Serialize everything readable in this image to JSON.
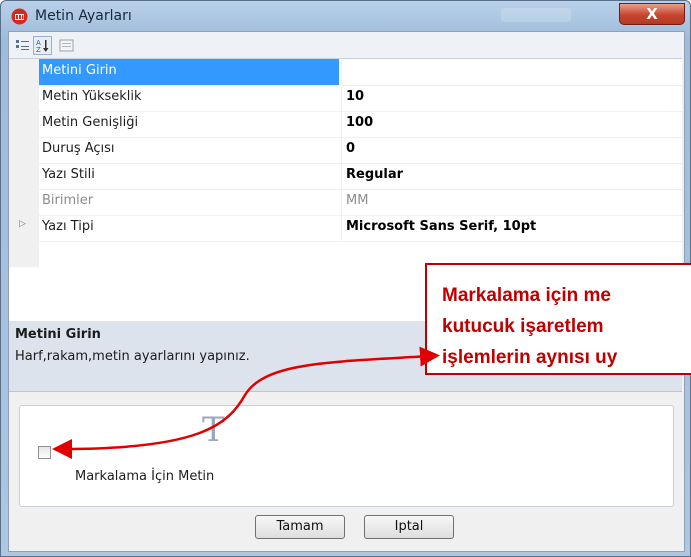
{
  "window": {
    "title": "Metin Ayarları",
    "close_icon": "x-icon",
    "close_glyph": "X"
  },
  "toolbar": {
    "icons": [
      "categorized-icon",
      "alphabetical-sort-icon",
      "property-pages-icon"
    ]
  },
  "property_grid": {
    "rows": [
      {
        "name": "Metini Girin",
        "value": "",
        "selected": true
      },
      {
        "name": "Metin Yükseklik",
        "value": "10"
      },
      {
        "name": "Metin Genişliği",
        "value": "100"
      },
      {
        "name": "Duruş Açısı",
        "value": "0"
      },
      {
        "name": "Yazı Stili",
        "value": "Regular"
      },
      {
        "name": "Birimler",
        "value": "MM",
        "disabled": true
      },
      {
        "name": "Yazı Tipi",
        "value": "Microsoft Sans Serif, 10pt",
        "expandable": true
      }
    ],
    "expander_glyph": "▷"
  },
  "description": {
    "title": "Metini Girin",
    "text": "Harf,rakam,metin ayarlarını yapınız."
  },
  "panel": {
    "icon": "text-tool-icon",
    "icon_glyph": "T",
    "checkbox_checked": false,
    "checkbox_label": "Markalama İçin Metin"
  },
  "buttons": {
    "ok": "Tamam",
    "cancel": "Iptal"
  },
  "callout": {
    "lines": [
      "Markalama için me",
      "kutucuk   işaretlem",
      "işlemlerin aynısı uy"
    ]
  },
  "colors": {
    "callout_red": "#e00000",
    "selection_blue": "#3399ff"
  }
}
